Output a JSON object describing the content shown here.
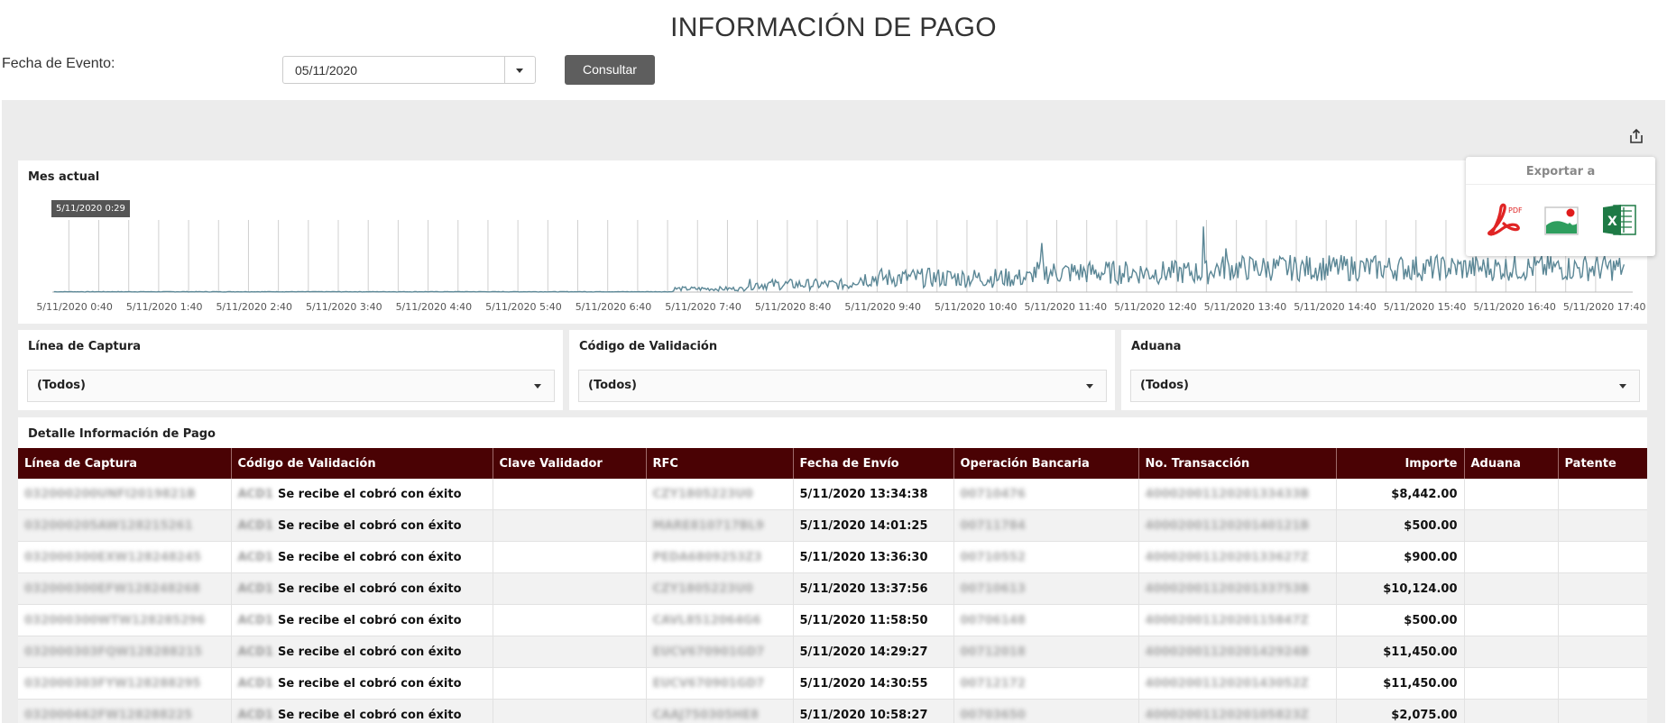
{
  "page": {
    "title": "INFORMACIÓN DE PAGO"
  },
  "filter": {
    "label": "Fecha de Evento:",
    "date_value": "05/11/2020",
    "consult_label": "Consultar"
  },
  "chart_panel": {
    "title": "Mes actual",
    "tooltip": "5/11/2020 0:29"
  },
  "chart_data": {
    "type": "line",
    "title": "Mes actual",
    "x_ticks": [
      "5/11/2020 0:40",
      "5/11/2020 1:40",
      "5/11/2020 2:40",
      "5/11/2020 3:40",
      "5/11/2020 4:40",
      "5/11/2020 5:40",
      "5/11/2020 6:40",
      "5/11/2020 7:40",
      "5/11/2020 8:40",
      "5/11/2020 9:40",
      "5/11/2020 10:40",
      "5/11/2020 11:40",
      "5/11/2020 12:40",
      "5/11/2020 13:40",
      "5/11/2020 14:40",
      "5/11/2020 15:40",
      "5/11/2020 16:40",
      "5/11/2020 17:40"
    ],
    "x_range": [
      "0:29",
      "18:05"
    ],
    "series": [
      {
        "color": "#5b8796",
        "segments": [
          {
            "from_hour": 0.5,
            "to_hour": 7.4,
            "level": 0.3,
            "spread": 0.2
          },
          {
            "from_hour": 7.4,
            "to_hour": 8.2,
            "level": 3,
            "spread": 2
          },
          {
            "from_hour": 8.2,
            "to_hour": 9.4,
            "level": 7,
            "spread": 5
          },
          {
            "from_hour": 9.4,
            "to_hour": 11.4,
            "level": 13,
            "spread": 9
          },
          {
            "from_hour": 11.4,
            "to_hour": 13.4,
            "level": 18,
            "spread": 11
          },
          {
            "from_hour": 13.4,
            "to_hour": 18.0,
            "level": 22,
            "spread": 12
          }
        ],
        "peaks": [
          {
            "hour": 13.3,
            "value": 60
          },
          {
            "hour": 11.5,
            "value": 45
          },
          {
            "hour": 13.55,
            "value": 40
          }
        ]
      }
    ],
    "ymax": 66,
    "grid": "vertical",
    "legend": "none"
  },
  "export": {
    "title": "Exportar a",
    "options": [
      {
        "name": "pdf-icon",
        "label": "PDF",
        "color": "#e02424"
      },
      {
        "name": "image-icon",
        "color": "#2e9e5e"
      },
      {
        "name": "excel-icon",
        "label": "X",
        "color": "#1e7a45"
      }
    ]
  },
  "filters": [
    {
      "title": "Línea de Captura",
      "value": "(Todos)"
    },
    {
      "title": "Código de Validación",
      "value": "(Todos)"
    },
    {
      "title": "Aduana",
      "value": "(Todos)"
    }
  ],
  "table": {
    "title": "Detalle Información de Pago",
    "columns": [
      "Línea de Captura",
      "Código de Validación",
      "Clave Validador",
      "RFC",
      "Fecha de Envío",
      "Operación Bancaria",
      "No. Transacción",
      "Importe",
      "Aduana",
      "Patente"
    ],
    "rows": [
      {
        "linea": "032000200UNFI2019821B",
        "codigo_prefix": "ACD1",
        "codigo": "Se recibe el cobró con éxito",
        "clave": "",
        "rfc": "CZY1805223U0",
        "fecha": "5/11/2020 13:34:38",
        "operacion": "00710476",
        "transaccion": "4000200112020133433B",
        "importe": "$8,442.00",
        "aduana": "",
        "patente": ""
      },
      {
        "linea": "032000205AW128215261",
        "codigo_prefix": "ACD1",
        "codigo": "Se recibe el cobró con éxito",
        "clave": "",
        "rfc": "MARE810717BL9",
        "fecha": "5/11/2020 14:01:25",
        "operacion": "00711784",
        "transaccion": "4000200112020140121B",
        "importe": "$500.00",
        "aduana": "",
        "patente": ""
      },
      {
        "linea": "032000300EXW128248245",
        "codigo_prefix": "ACD1",
        "codigo": "Se recibe el cobró con éxito",
        "clave": "",
        "rfc": "PEDA6809253Z3",
        "fecha": "5/11/2020 13:36:30",
        "operacion": "00710552",
        "transaccion": "4000200112020133627Z",
        "importe": "$900.00",
        "aduana": "",
        "patente": ""
      },
      {
        "linea": "032000300EFW128248268",
        "codigo_prefix": "ACD1",
        "codigo": "Se recibe el cobró con éxito",
        "clave": "",
        "rfc": "CZY1805223U0",
        "fecha": "5/11/2020 13:37:56",
        "operacion": "00710613",
        "transaccion": "4000200112020133753B",
        "importe": "$10,124.00",
        "aduana": "",
        "patente": ""
      },
      {
        "linea": "032000300WTW128285296",
        "codigo_prefix": "ACD1",
        "codigo": "Se recibe el cobró con éxito",
        "clave": "",
        "rfc": "CAVL8512064G6",
        "fecha": "5/11/2020 11:58:50",
        "operacion": "00706148",
        "transaccion": "4000200112020115847Z",
        "importe": "$500.00",
        "aduana": "",
        "patente": ""
      },
      {
        "linea": "032000303FQW128288215",
        "codigo_prefix": "ACD1",
        "codigo": "Se recibe el cobró con éxito",
        "clave": "",
        "rfc": "EUCV670901GD7",
        "fecha": "5/11/2020 14:29:27",
        "operacion": "00712018",
        "transaccion": "4000200112020142924B",
        "importe": "$11,450.00",
        "aduana": "",
        "patente": ""
      },
      {
        "linea": "032000303FYW128288295",
        "codigo_prefix": "ACD1",
        "codigo": "Se recibe el cobró con éxito",
        "clave": "",
        "rfc": "EUCV670901GD7",
        "fecha": "5/11/2020 14:30:55",
        "operacion": "00712172",
        "transaccion": "4000200112020143052Z",
        "importe": "$11,450.00",
        "aduana": "",
        "patente": ""
      },
      {
        "linea": "032000462FW128288225",
        "codigo_prefix": "ACD1",
        "codigo": "Se recibe el cobró con éxito",
        "clave": "",
        "rfc": "CAAJ750305HE8",
        "fecha": "5/11/2020 10:58:27",
        "operacion": "00703650",
        "transaccion": "4000200112020105823Z",
        "importe": "$2,075.00",
        "aduana": "",
        "patente": ""
      }
    ]
  }
}
